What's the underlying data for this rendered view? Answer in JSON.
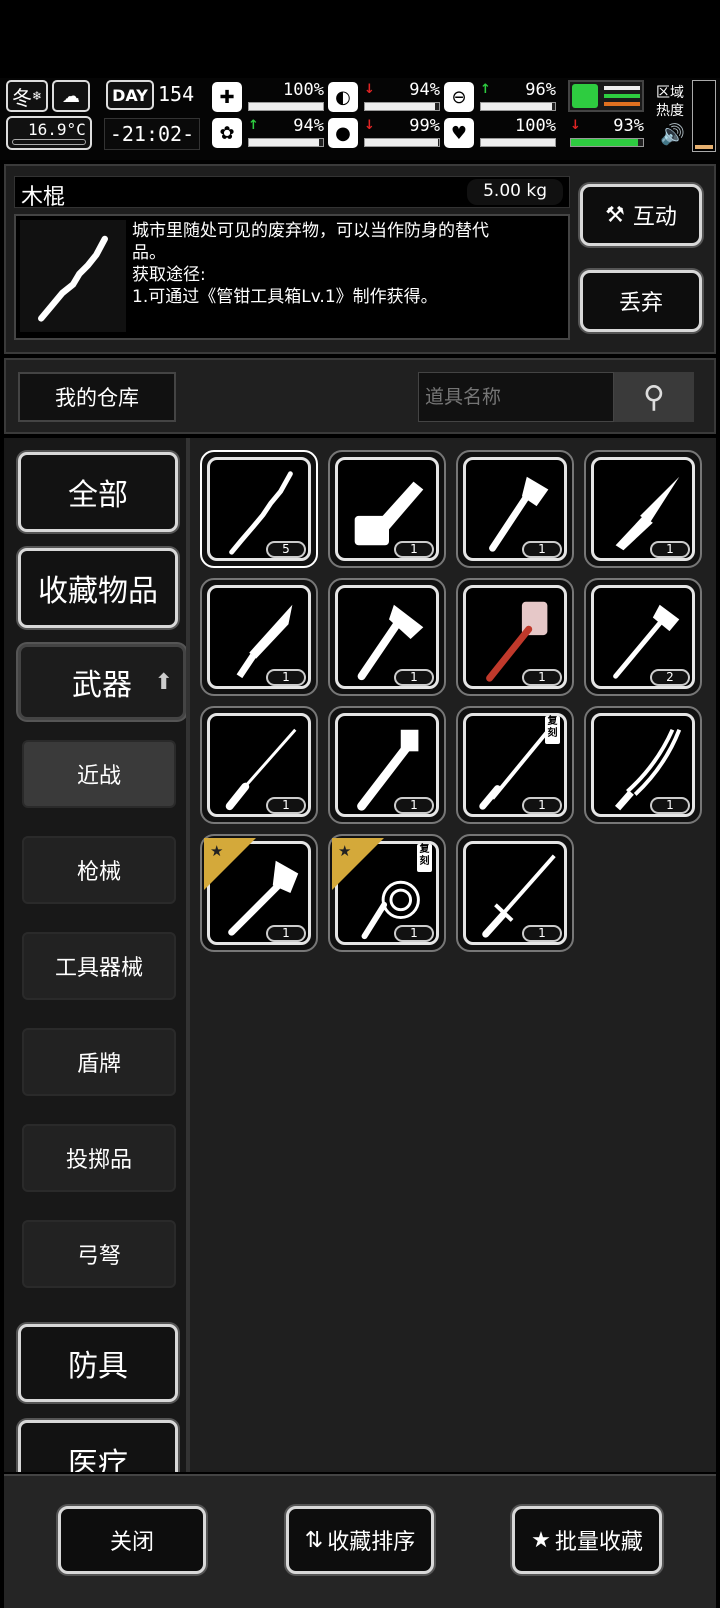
{
  "hud": {
    "season": "冬",
    "temperature": "16.9°C",
    "day_label": "DAY",
    "day": "154",
    "time": "-21:02-",
    "region_heat": "区域\n热度",
    "stats": [
      {
        "icon": "medkit-icon",
        "value": "100%",
        "fill": 1.0,
        "arrow": ""
      },
      {
        "icon": "stomach-icon",
        "value": "94%",
        "fill": 0.94,
        "arrow": "down"
      },
      {
        "icon": "stamina-icon",
        "value": "96%",
        "fill": 0.96,
        "arrow": "up"
      },
      {
        "icon": "brain-icon",
        "value": "94%",
        "fill": 0.94,
        "arrow": "up"
      },
      {
        "icon": "water-drop-icon",
        "value": "99%",
        "fill": 0.99,
        "arrow": "down"
      },
      {
        "icon": "heart-icon",
        "value": "100%",
        "fill": 1.0,
        "arrow": ""
      },
      {
        "icon": "boot-icon",
        "value": "93%",
        "fill": 0.93,
        "arrow": "down"
      }
    ]
  },
  "item": {
    "name": "木棍",
    "weight": "5.00 kg",
    "desc_line1": "城市里随处可见的废弃物，可以当作防身的替代",
    "desc_line2": "品。",
    "desc_line3": "获取途径:",
    "desc_line4": "1.可通过《管钳工具箱Lv.1》制作获得。",
    "interact_label": "互动",
    "discard_label": "丢弃"
  },
  "storage": {
    "title": "我的仓库",
    "search_placeholder": "道具名称"
  },
  "categories": {
    "all": "全部",
    "favorites": "收藏物品",
    "weapons": "武器",
    "armor": "防具",
    "medical": "医疗"
  },
  "subcategories": [
    "近战",
    "枪械",
    "工具器械",
    "盾牌",
    "投掷品",
    "弓弩"
  ],
  "items": [
    {
      "name": "wooden-stick",
      "count": "5"
    },
    {
      "name": "chainsaw",
      "count": "1"
    },
    {
      "name": "hatchet",
      "count": "1"
    },
    {
      "name": "folding-knife",
      "count": "1"
    },
    {
      "name": "machete",
      "count": "1"
    },
    {
      "name": "axe",
      "count": "1"
    },
    {
      "name": "spiked-hammer",
      "count": "1"
    },
    {
      "name": "fire-axe",
      "count": "2"
    },
    {
      "name": "baton",
      "count": "1"
    },
    {
      "name": "pipe-wrench",
      "count": "1"
    },
    {
      "name": "replica-sword",
      "count": "1",
      "badge": "复刻"
    },
    {
      "name": "katana",
      "count": "1"
    },
    {
      "name": "shovel",
      "count": "1"
    },
    {
      "name": "whip",
      "count": "1",
      "badge": "复刻"
    },
    {
      "name": "long-sword",
      "count": "1"
    }
  ],
  "bottom": {
    "close": "关闭",
    "sort": "收藏排序",
    "batch": "批量收藏"
  }
}
